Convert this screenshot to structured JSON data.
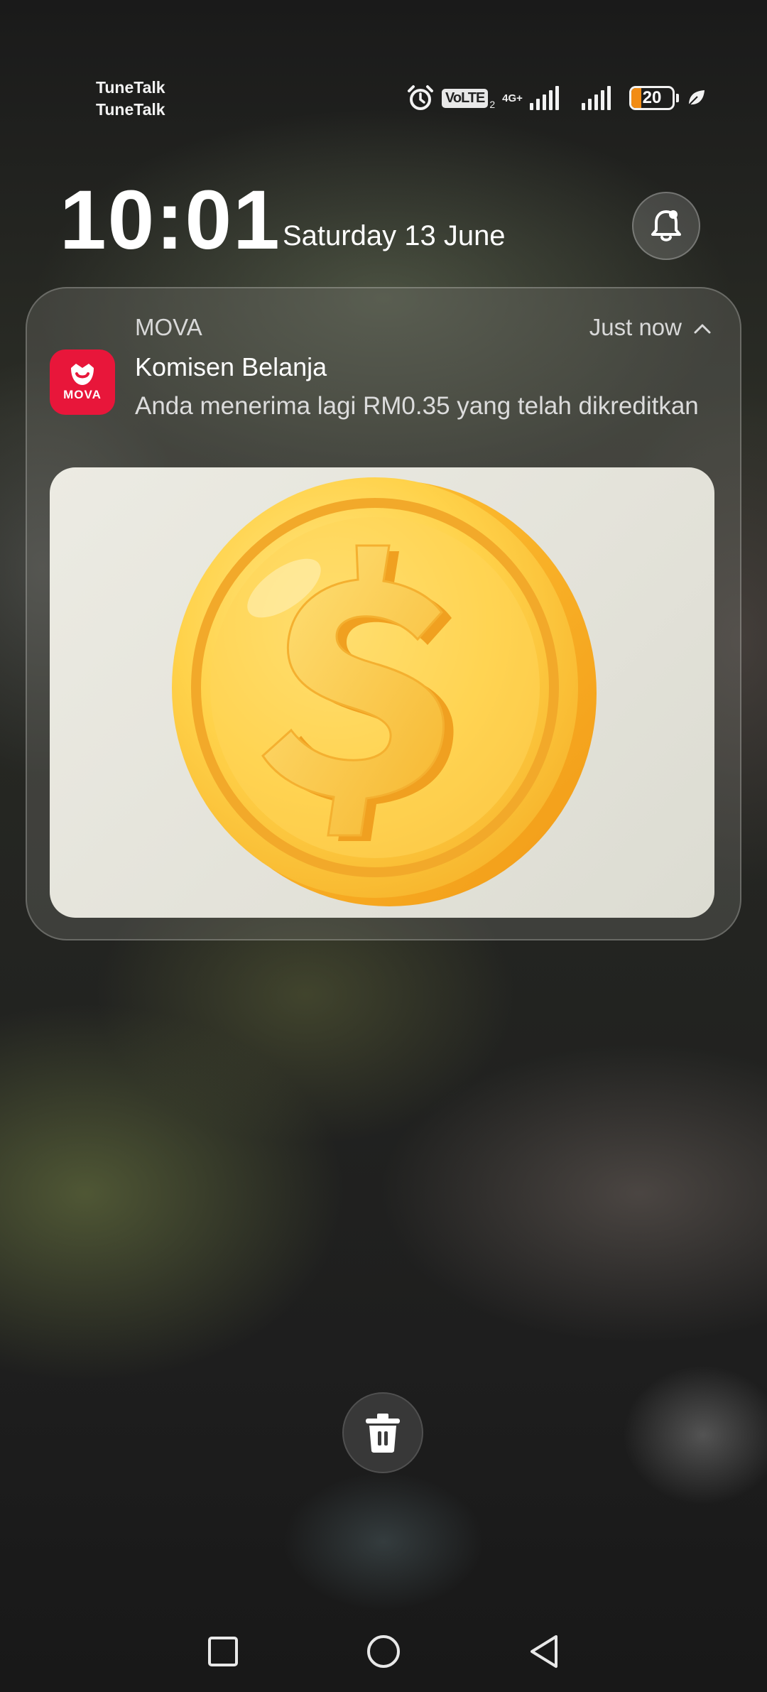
{
  "status_bar": {
    "carrier_1": "TuneTalk",
    "carrier_2": "TuneTalk",
    "volte": "VoLTE",
    "sim_slot": "2",
    "network": "4G+",
    "battery_level": "20",
    "battery_color": "#f28c14"
  },
  "lockscreen": {
    "time": "10:01",
    "date": "Saturday 13 June"
  },
  "notification": {
    "app_name": "MOVA",
    "app_icon_label": "MOVA",
    "app_icon_color": "#e8163a",
    "time": "Just now",
    "title": "Komisen Belanja",
    "body": "Anda menerima lagi RM0.35 yang telah dikreditkan"
  }
}
